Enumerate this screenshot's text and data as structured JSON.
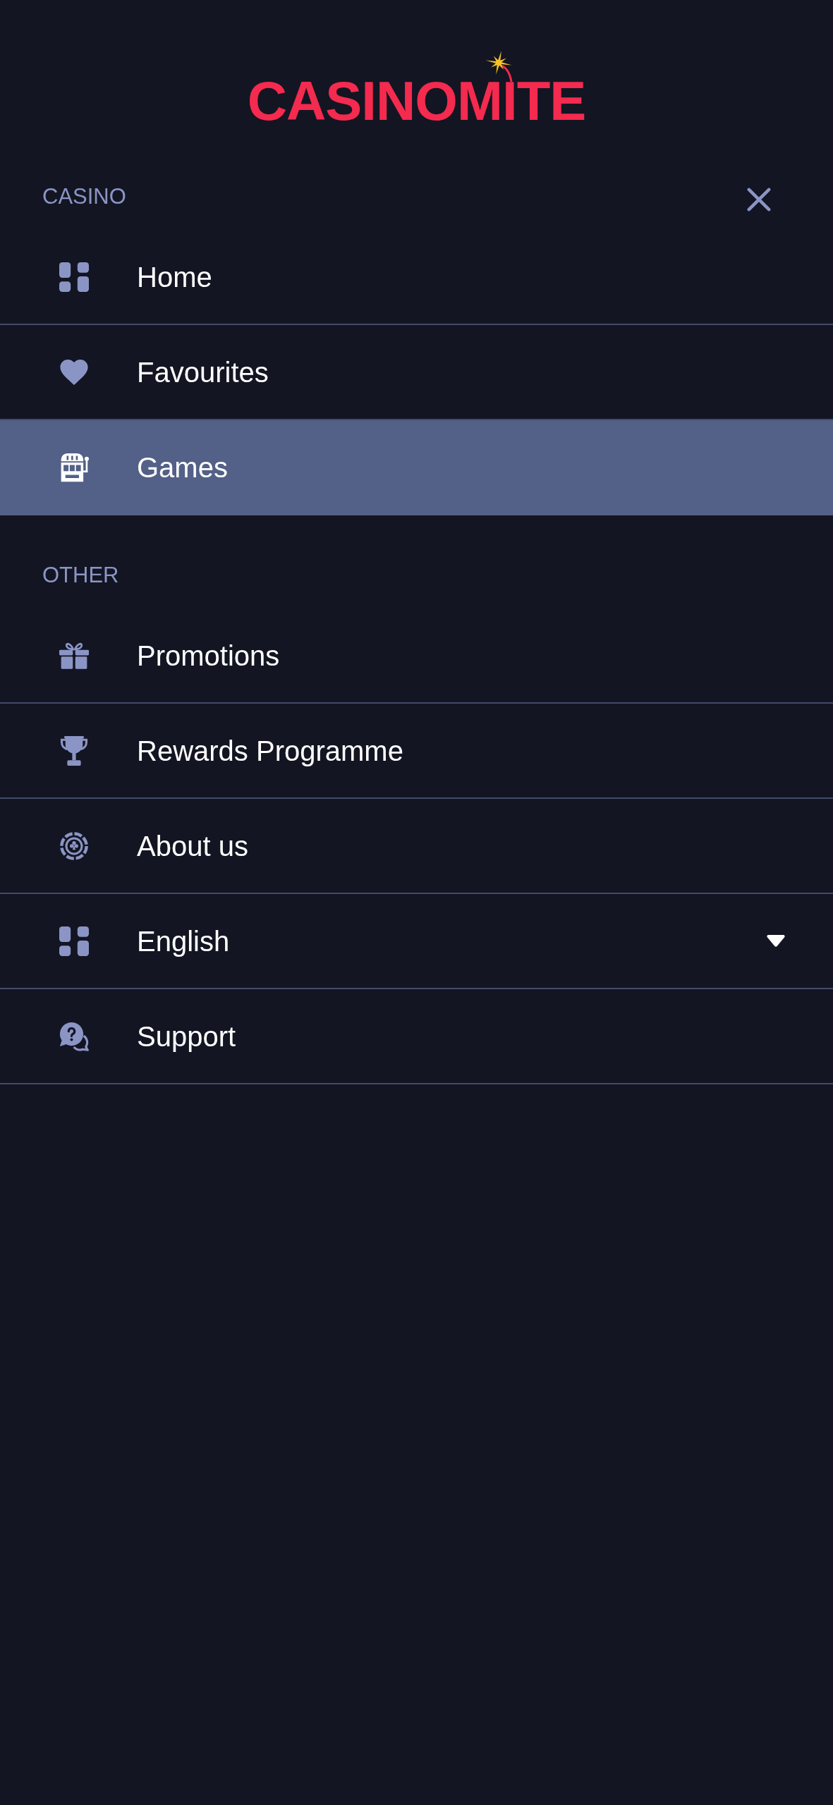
{
  "logo": {
    "text": "CASINOMITE"
  },
  "sections": [
    {
      "title": "CASINO",
      "items": [
        {
          "label": "Home",
          "kind": "link",
          "selected": false
        },
        {
          "label": "Favourites",
          "kind": "link",
          "selected": false
        },
        {
          "label": "Games",
          "kind": "link",
          "selected": true
        }
      ]
    },
    {
      "title": "OTHER",
      "items": [
        {
          "label": "Promotions",
          "kind": "link",
          "selected": false
        },
        {
          "label": "Rewards Programme",
          "kind": "link",
          "selected": false
        },
        {
          "label": "About us",
          "kind": "link",
          "selected": false
        },
        {
          "label": "English",
          "kind": "dropdown",
          "selected": false
        },
        {
          "label": "Support",
          "kind": "link",
          "selected": false
        }
      ]
    }
  ]
}
